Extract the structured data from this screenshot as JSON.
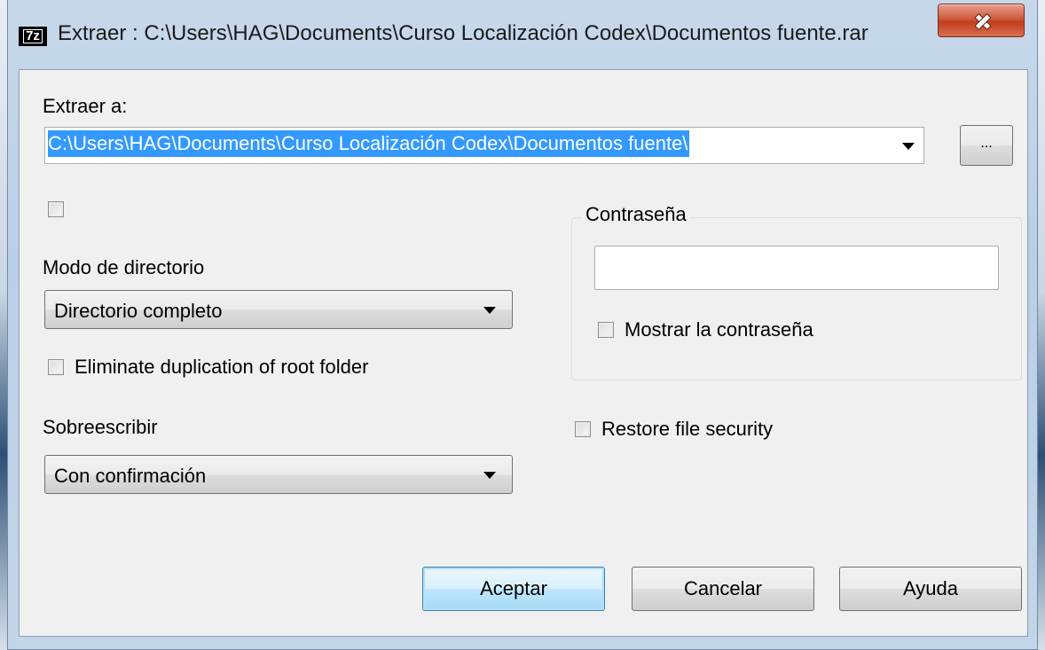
{
  "window": {
    "app_icon_text": "7z",
    "title": "Extraer : C:\\Users\\HAG\\Documents\\Curso Localización Codex\\Documentos fuente.rar"
  },
  "extract_to": {
    "label": "Extraer a:",
    "path": "C:\\Users\\HAG\\Documents\\Curso Localización Codex\\Documentos fuente\\",
    "browse_label": "..."
  },
  "unnamed_checkbox": {
    "checked": false
  },
  "directory_mode": {
    "label": "Modo de directorio",
    "selected": "Directorio completo"
  },
  "eliminate_root": {
    "label": "Eliminate duplication of root folder",
    "checked": false
  },
  "overwrite": {
    "label": "Sobreescribir",
    "selected": "Con confirmación"
  },
  "password": {
    "group_title": "Contraseña",
    "value": "",
    "show_label": "Mostrar la contraseña",
    "show_checked": false
  },
  "restore_security": {
    "label": "Restore file security",
    "checked": false
  },
  "buttons": {
    "ok": "Aceptar",
    "cancel": "Cancelar",
    "help": "Ayuda"
  }
}
